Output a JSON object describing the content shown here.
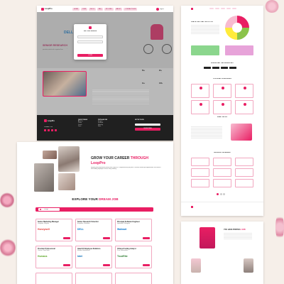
{
  "brand": {
    "name": "LoopPro",
    "accent": "#e91e63"
  },
  "nav": {
    "items": [
      "HOME",
      "JOBS",
      "BLOG",
      "FAQ",
      "MY JOBS",
      "ABOUT",
      "CONTACT NOW"
    ],
    "login_label": "Sign In"
  },
  "hero": {
    "company": "DELL",
    "role": "SENIOR RESEARCH",
    "description": "Join our team as a senior research engineer building next generation products with a supportive team."
  },
  "login_modal": {
    "title": "Sell Your Moment",
    "email_placeholder": "Email",
    "password_placeholder": "Password",
    "submit_label": "LOGIN"
  },
  "stats": [
    {
      "value": "5k+",
      "label": "Jobs"
    },
    {
      "value": "2k+",
      "label": "Companies"
    },
    {
      "value": "1k+",
      "label": "Candidates"
    },
    {
      "value": "100+",
      "label": "Partners"
    }
  ],
  "footer": {
    "connect_label": "CONNECT US",
    "col1_title": "QUICK THINGS",
    "col1_items": [
      "About Us",
      "Privacy",
      "Contact",
      "Terms"
    ],
    "col2_title": "POPULAR JOB",
    "col2_items": [
      "Designer",
      "Developer",
      "Marketing",
      "Writer"
    ],
    "col3_title": "GET IN TOUCH",
    "subscribe_label": "SUBSCRIBE"
  },
  "career": {
    "heading_prefix": "GROW YOUR CAREER",
    "heading_accent": "THROUGH",
    "brand": "LoopPro",
    "body": "Elevate your professional journey with LoopPro, a comprehensive job portal. Discover tailored job opportunities and connect with leading employers across every industry."
  },
  "explore": {
    "heading_prefix": "EXPLORE YOUR",
    "heading_accent": "DREAM JOB",
    "search_label": "Design",
    "jobs": [
      {
        "title": "Senior Marketing Manager",
        "location": "Gurugram, Haryana",
        "logo": "Honeywell",
        "logo_color": "#e53935"
      },
      {
        "title": "Senior Research Scientist",
        "location": "Bangalore, Karnataka",
        "logo": "DELL",
        "logo_color": "#0076ce"
      },
      {
        "title": "Principal Software Engineer",
        "location": "Hyderabad, Telangana",
        "logo": "Walmart",
        "logo_color": "#0071ce"
      },
      {
        "title": "Provider Professional",
        "location": "Chennai, Tamil Nadu",
        "logo": "Humana",
        "logo_color": "#5fa829"
      },
      {
        "title": "Head Of Employee Relations",
        "location": "Mumbai, Maharashtra",
        "logo": "Intel",
        "logo_color": "#0068b5"
      },
      {
        "title": "Clinical Coding Analyst",
        "location": "Pune, Maharashtra",
        "logo": "TrustRite",
        "logo_color": "#2e7d32"
      }
    ]
  },
  "mobile": {
    "stats_heading": "FIND A JOB THAT SUITS YOU",
    "download_heading": "DOWNLOAD THE MOBILE APP",
    "categories_heading": "POPULAR CATEGORIES",
    "about_heading": "WHAT WE DO",
    "jobs_heading": "BROWSE JOB AREAS",
    "post_heading": "YOU HAVE POSTED",
    "post_accent": "A JOB"
  }
}
